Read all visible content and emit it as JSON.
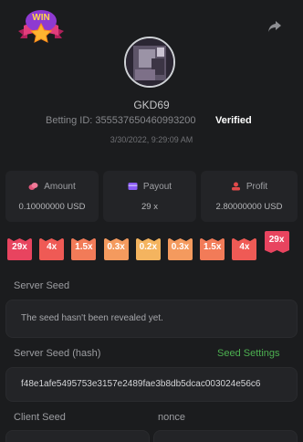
{
  "logo": {
    "text": "WIN"
  },
  "user": {
    "name": "GKD69"
  },
  "bet": {
    "id_label": "Betting ID:",
    "id_value": "355537650460993200",
    "status": "Verified",
    "timestamp": "3/30/2022, 9:29:09 AM"
  },
  "stats": [
    {
      "label": "Amount",
      "value": "0.10000000 USD",
      "icon": "coins-icon",
      "color": "#e0567a"
    },
    {
      "label": "Payout",
      "value": "29 x",
      "icon": "wallet-icon",
      "color": "#8b5cf6"
    },
    {
      "label": "Profit",
      "value": "2.80000000 USD",
      "icon": "profit-icon",
      "color": "#e04a4a"
    }
  ],
  "multipliers": [
    {
      "label": "29x",
      "color": "#e8445f"
    },
    {
      "label": "4x",
      "color": "#ef5a55"
    },
    {
      "label": "1.5x",
      "color": "#f27b58"
    },
    {
      "label": "0.3x",
      "color": "#f49a5e"
    },
    {
      "label": "0.2x",
      "color": "#f4b45f"
    },
    {
      "label": "0.3x",
      "color": "#f49a5e"
    },
    {
      "label": "1.5x",
      "color": "#f27b58"
    },
    {
      "label": "4x",
      "color": "#ef5a55"
    },
    {
      "label": "29x",
      "color": "#e8445f",
      "selected": true
    }
  ],
  "server_seed": {
    "label": "Server Seed",
    "value": "The seed hasn't been revealed yet."
  },
  "server_seed_hash": {
    "label": "Server Seed (hash)",
    "value": "f48e1afe5495753e3157e2489fae3b8db5dcac003024e56c6",
    "settings_link": "Seed Settings"
  },
  "client_seed": {
    "label": "Client Seed"
  },
  "nonce": {
    "label": "nonce"
  }
}
